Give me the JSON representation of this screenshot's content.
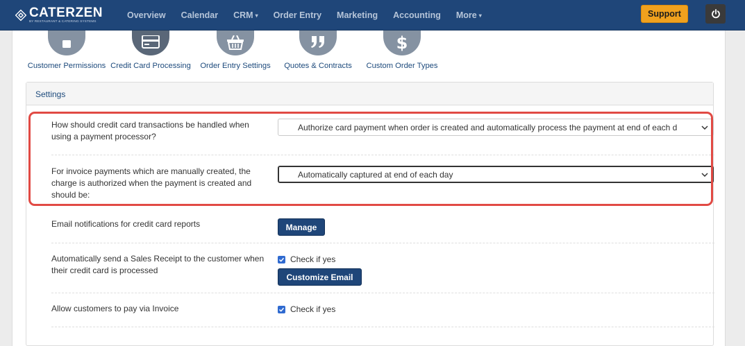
{
  "brand": {
    "name": "CATERZEN",
    "tagline": "BY RESTAURANT & CATERING SYSTEMS"
  },
  "nav": {
    "items": [
      {
        "label": "Overview",
        "dropdown": false
      },
      {
        "label": "Calendar",
        "dropdown": false
      },
      {
        "label": "CRM",
        "dropdown": true
      },
      {
        "label": "Order Entry",
        "dropdown": false
      },
      {
        "label": "Marketing",
        "dropdown": false
      },
      {
        "label": "Accounting",
        "dropdown": false
      },
      {
        "label": "More",
        "dropdown": true
      }
    ],
    "support_label": "Support",
    "power_icon": "power-icon"
  },
  "icon_row": [
    {
      "label": "Customer Permissions",
      "icon": "lock-icon"
    },
    {
      "label": "Credit Card Processing",
      "icon": "credit-card-icon"
    },
    {
      "label": "Order Entry Settings",
      "icon": "basket-icon"
    },
    {
      "label": "Quotes & Contracts",
      "icon": "quote-icon"
    },
    {
      "label": "Custom Order Types",
      "icon": "dollar-icon"
    }
  ],
  "settings": {
    "title": "Settings",
    "cc_handling": {
      "label": "How should credit card transactions be handled when using a payment processor?",
      "value": "Authorize card payment when order is created and automatically process the payment at end of each d"
    },
    "invoice_capture": {
      "label": "For invoice payments which are manually created, the charge is authorized when the payment is created and should be:",
      "value": "Automatically captured at end of each day"
    },
    "email_notifications": {
      "label": "Email notifications for credit card reports",
      "button": "Manage"
    },
    "sales_receipt": {
      "label": "Automatically send a Sales Receipt to the customer when their credit card is processed",
      "checkbox_label": "Check if yes",
      "checked": true,
      "button": "Customize Email"
    },
    "pay_via_invoice": {
      "label": "Allow customers to pay via Invoice",
      "checkbox_label": "Check if yes",
      "checked": true
    }
  },
  "colors": {
    "navbar": "#1f4679",
    "support": "#f0a11e",
    "highlight": "#e14a44",
    "checkbox": "#2f6ad0"
  }
}
